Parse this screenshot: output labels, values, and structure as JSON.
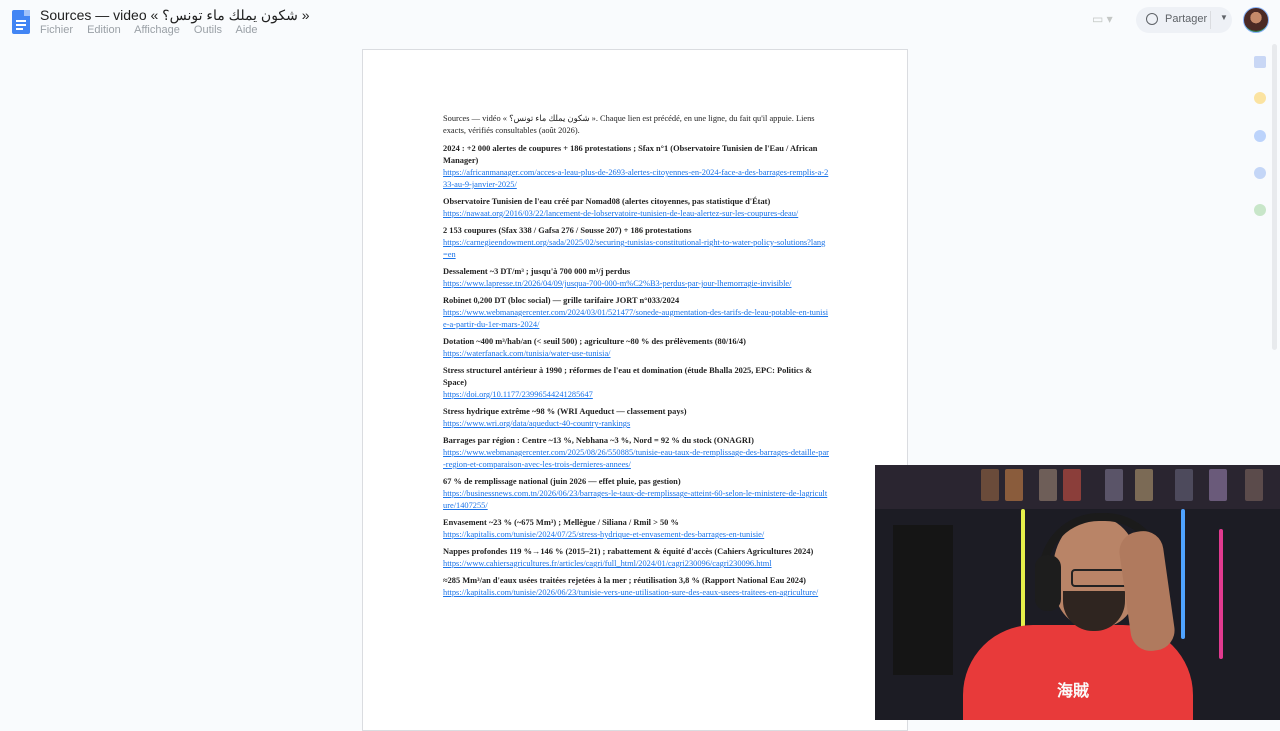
{
  "app": {
    "doc_title": "Sources — video « شكون يملك ماء تونس؟ »",
    "menus": [
      "Fichier",
      "Edition",
      "Affichage",
      "Outils",
      "Aide"
    ],
    "share_label": "Partager",
    "accent": "#1a73e8"
  },
  "doc": {
    "intro": "Sources — vidéo « شكون يملك ماء تونس؟ ». Chaque lien est précédé, en une ligne, du fait qu'il appuie. Liens exacts, vérifiés consultables (août 2026).",
    "entries": [
      {
        "head": "2024 : +2 000 alertes de coupures + 186 protestations ; Sfax n°1 (Observatoire Tunisien de l'Eau / African Manager)",
        "link": "https://africanmanager.com/acces-a-leau-plus-de-2693-alertes-citoyennes-en-2024-face-a-des-barrages-remplis-a-233-au-9-janvier-2025/"
      },
      {
        "head": "Observatoire Tunisien de l'eau créé par Nomad08 (alertes citoyennes, pas statistique d'État)",
        "link": "https://nawaat.org/2016/03/22/lancement-de-lobservatoire-tunisien-de-leau-alertez-sur-les-coupures-deau/"
      },
      {
        "head": "2 153 coupures (Sfax 338 / Gafsa 276 / Sousse 207) + 186 protestations",
        "link": "https://carnegieendowment.org/sada/2025/02/securing-tunisias-constitutional-right-to-water-policy-solutions?lang=en"
      },
      {
        "head": "Dessalement ~3 DT/m³ ; jusqu'à 700 000 m³/j perdus",
        "link": "https://www.lapresse.tn/2026/04/09/jusqua-700-000-m%C2%B3-perdus-par-jour-lhemorragie-invisible/"
      },
      {
        "head": "Robinet 0,200 DT (bloc social) — grille tarifaire JORT n°033/2024",
        "link": "https://www.webmanagercenter.com/2024/03/01/521477/sonede-augmentation-des-tarifs-de-leau-potable-en-tunisie-a-partir-du-1er-mars-2024/"
      },
      {
        "head": "Dotation ~400 m³/hab/an (< seuil 500) ; agriculture ~80 % des prélèvements (80/16/4)",
        "link": "https://waterfanack.com/tunisia/water-use-tunisia/"
      },
      {
        "head": "Stress structurel antérieur à 1990 ; réformes de l'eau et domination (étude Bhalla 2025, EPC: Politics & Space)",
        "link": "https://doi.org/10.1177/23996544241285647"
      },
      {
        "head": "Stress hydrique extrême ~98 % (WRI Aqueduct — classement pays)",
        "link": "https://www.wri.org/data/aqueduct-40-country-rankings"
      },
      {
        "head": "Barrages par région : Centre ~13 %, Nebhana ~3 %, Nord = 92 % du stock (ONAGRI)",
        "link": "https://www.webmanagercenter.com/2025/08/26/550885/tunisie-eau-taux-de-remplissage-des-barrages-detaille-par-region-et-comparaison-avec-les-trois-dernieres-annees/"
      },
      {
        "head": "67 % de remplissage national (juin 2026 — effet pluie, pas gestion)",
        "link": "https://businessnews.com.tn/2026/06/23/barrages-le-taux-de-remplissage-atteint-60-selon-le-ministere-de-lagriculture/1407255/"
      },
      {
        "head": "Envasement ~23 % (~675 Mm³) ; Mellègue / Siliana / Rmil > 50 %",
        "link": "https://kapitalis.com/tunisie/2024/07/25/stress-hydrique-et-envasement-des-barrages-en-tunisie/"
      },
      {
        "head": "Nappes profondes 119 %→146 % (2015–21) ; rabattement & équité d'accès (Cahiers Agricultures 2024)",
        "link": "https://www.cahiersagricultures.fr/articles/cagri/full_html/2024/01/cagri230096/cagri230096.html"
      },
      {
        "head": "≈285 Mm³/an d'eaux usées traitées rejetées à la mer ; réutilisation 3,8 % (Rapport National Eau 2024)",
        "link": "https://kapitalis.com/tunisie/2026/06/23/tunisie-vers-une-utilisation-sure-des-eaux-usees-traitees-en-agriculture/"
      }
    ]
  },
  "webcam": {
    "shirt_print": "海賊"
  }
}
